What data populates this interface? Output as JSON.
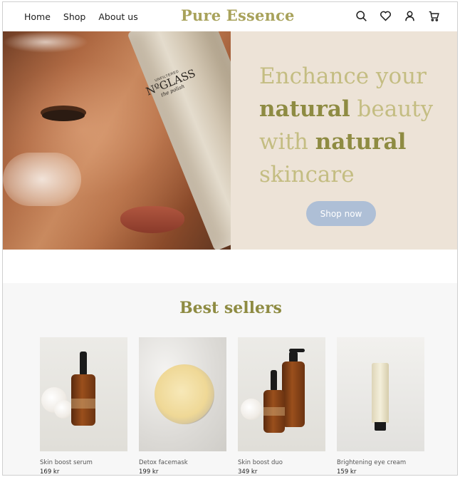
{
  "header": {
    "nav": [
      "Home",
      "Shop",
      "About us"
    ],
    "logo": "Pure Essence",
    "icons": [
      "search-icon",
      "heart-icon",
      "user-icon",
      "cart-icon"
    ]
  },
  "hero": {
    "headline_1": "Enchance your",
    "headline_2a": "natural",
    "headline_2b": "beauty",
    "headline_3a": "with",
    "headline_3b": "natural",
    "headline_4": "skincare",
    "cta": "Shop now",
    "tube_small": "UNFILTERED",
    "tube_brand": "NºGLASS",
    "tube_sub": "the polish"
  },
  "best_sellers": {
    "title": "Best sellers",
    "products": [
      {
        "name": "Skin boost serum",
        "price": "169 kr"
      },
      {
        "name": "Detox facemask",
        "price": "199 kr"
      },
      {
        "name": "Skin boost duo",
        "price": "349 kr"
      },
      {
        "name": "Brightening eye cream",
        "price": "159 kr"
      }
    ]
  },
  "colors": {
    "accent": "#8e8b42",
    "accent_light": "#c4bd82",
    "hero_panel": "#ede3d7",
    "button": "#aebfd6"
  }
}
